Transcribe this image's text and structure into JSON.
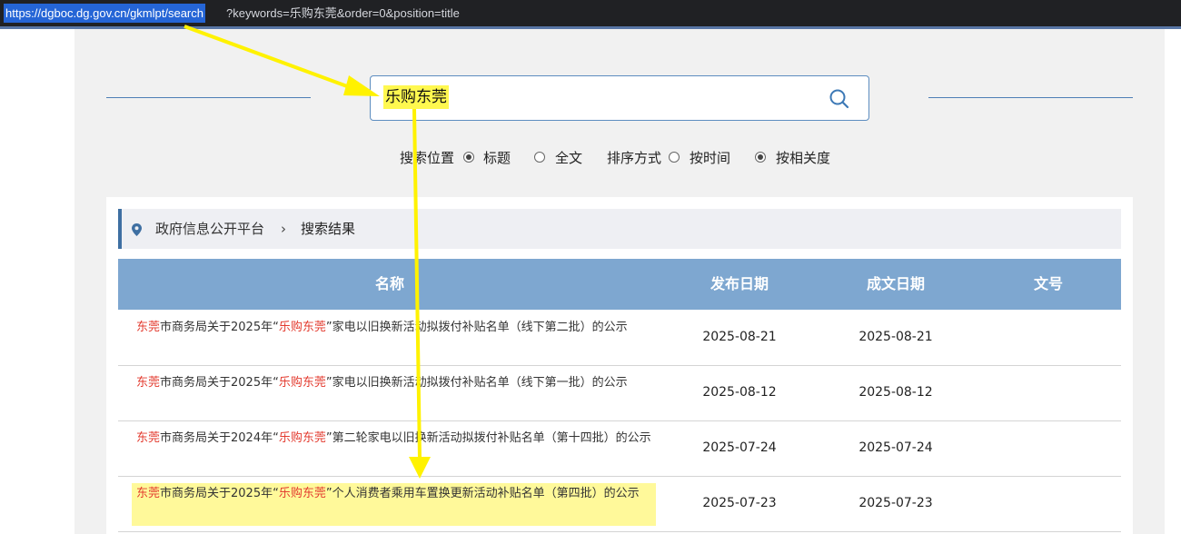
{
  "browser": {
    "url_selected": "https://dgboc.dg.gov.cn/gkmlpt/search",
    "url_rest": "?keywords=乐购东莞&order=0&position=title"
  },
  "search": {
    "query": "乐购东莞",
    "icon": "search-icon"
  },
  "options": {
    "position_label": "搜索位置",
    "position_title": "标题",
    "position_fulltext": "全文",
    "sort_label": "排序方式",
    "sort_time": "按时间",
    "sort_relevance": "按相关度",
    "selected_position": "标题",
    "selected_sort": "按相关度"
  },
  "breadcrumb": {
    "icon": "location-pin-icon",
    "home": "政府信息公开平台",
    "separator": "›",
    "current": "搜索结果"
  },
  "table": {
    "headers": [
      "名称",
      "发布日期",
      "成文日期",
      "文号"
    ],
    "rows": [
      {
        "title_prefix": "东莞",
        "title_mid1": "市商务局关于2025年“",
        "title_keyword": "乐购东莞",
        "title_rest": "”家电以旧换新活动拟拨付补贴名单（线下第二批）的公示",
        "publish_date": "2025-08-21",
        "written_date": "2025-08-21",
        "doc_no": ""
      },
      {
        "title_prefix": "东莞",
        "title_mid1": "市商务局关于2025年“",
        "title_keyword": "乐购东莞",
        "title_rest": "”家电以旧换新活动拟拨付补贴名单（线下第一批）的公示",
        "publish_date": "2025-08-12",
        "written_date": "2025-08-12",
        "doc_no": ""
      },
      {
        "title_prefix": "东莞",
        "title_mid1": "市商务局关于2024年“",
        "title_keyword": "乐购东莞",
        "title_rest": "”第二轮家电以旧换新活动拟拨付补贴名单（第十四批）的公示",
        "publish_date": "2025-07-24",
        "written_date": "2025-07-24",
        "doc_no": ""
      },
      {
        "title_prefix": "东莞",
        "title_mid1": "市商务局关于2025年“",
        "title_keyword": "乐购东莞",
        "title_rest": "”个人消费者乘用车置换更新活动补贴名单（第四批）的公示",
        "publish_date": "2025-07-23",
        "written_date": "2025-07-23",
        "doc_no": ""
      }
    ]
  },
  "colors": {
    "header_bg": "#7ea7d0",
    "keyword_red": "#e33a2e",
    "annotation_yellow": "#fff200",
    "highlight_yellow": "#fff99a"
  }
}
